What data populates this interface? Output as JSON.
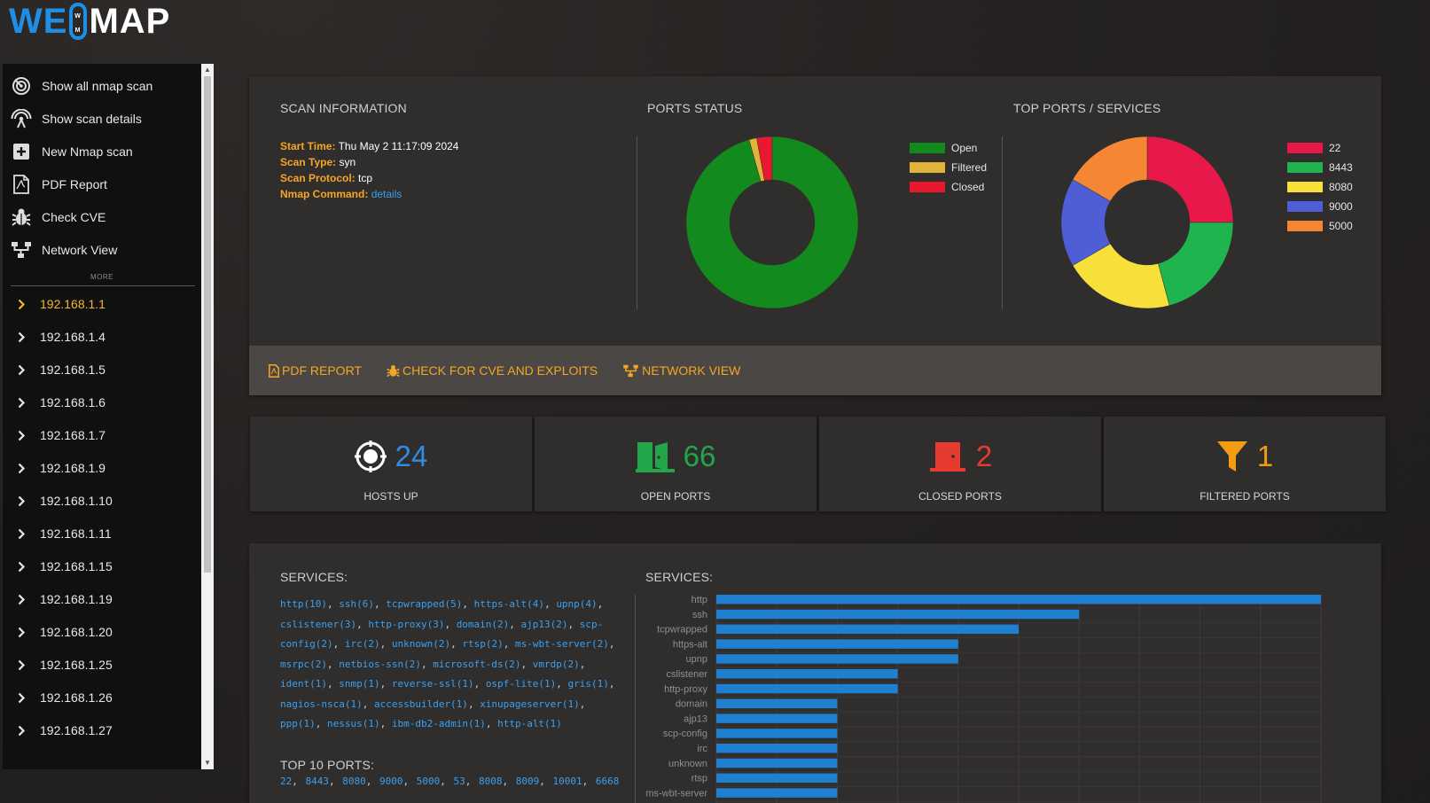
{
  "logo": {
    "part1": "WE",
    "part2": "MAP",
    "badge_letters": [
      "W",
      "M"
    ]
  },
  "sidebar": {
    "menu": [
      {
        "label": "Show all nmap scan",
        "icon": "radar-icon"
      },
      {
        "label": "Show scan details",
        "icon": "broadcast-icon"
      },
      {
        "label": "New Nmap scan",
        "icon": "plus-box-icon"
      },
      {
        "label": "PDF Report",
        "icon": "pdf-file-icon"
      },
      {
        "label": "Check CVE",
        "icon": "bug-icon"
      },
      {
        "label": "Network View",
        "icon": "network-icon"
      }
    ],
    "more_label": "MORE",
    "hosts": [
      "192.168.1.1",
      "192.168.1.4",
      "192.168.1.5",
      "192.168.1.6",
      "192.168.1.7",
      "192.168.1.9",
      "192.168.1.10",
      "192.168.1.11",
      "192.168.1.15",
      "192.168.1.19",
      "192.168.1.20",
      "192.168.1.25",
      "192.168.1.26",
      "192.168.1.27"
    ],
    "active_host": "192.168.1.1"
  },
  "scan_info": {
    "title": "SCAN INFORMATION",
    "start_time_label": "Start Time:",
    "start_time": "Thu May 2 11:17:09 2024",
    "scan_type_label": "Scan Type:",
    "scan_type": "syn",
    "scan_protocol_label": "Scan Protocol:",
    "scan_protocol": "tcp",
    "nmap_command_label": "Nmap Command:",
    "nmap_command_link": "details"
  },
  "ports_status": {
    "title": "PORTS STATUS",
    "legend": [
      {
        "label": "Open",
        "color": "#138a1e",
        "value": 66
      },
      {
        "label": "Filtered",
        "color": "#e0b438",
        "value": 1
      },
      {
        "label": "Closed",
        "color": "#e8192f",
        "value": 2
      }
    ]
  },
  "top_ports": {
    "title": "TOP PORTS / SERVICES",
    "legend": [
      {
        "label": "22",
        "color": "#e8194a",
        "value": 6
      },
      {
        "label": "8443",
        "color": "#1fb44e",
        "value": 5
      },
      {
        "label": "8080",
        "color": "#f7e03a",
        "value": 5
      },
      {
        "label": "9000",
        "color": "#4e5fd6",
        "value": 4
      },
      {
        "label": "5000",
        "color": "#f58634",
        "value": 4
      }
    ]
  },
  "actions": {
    "pdf_report": "PDF REPORT",
    "check_cve": "CHECK FOR CVE AND EXPLOITS",
    "network_view": "NETWORK VIEW"
  },
  "stats": [
    {
      "value": "24",
      "label": "HOSTS UP",
      "color": "#2d8ce6",
      "icon": "target-icon"
    },
    {
      "value": "66",
      "label": "OPEN PORTS",
      "color": "#22a64a",
      "icon": "door-open-icon"
    },
    {
      "value": "2",
      "label": "CLOSED PORTS",
      "color": "#e63b2e",
      "icon": "door-closed-icon"
    },
    {
      "value": "1",
      "label": "FILTERED PORTS",
      "color": "#f39c12",
      "icon": "filter-icon"
    }
  ],
  "services": {
    "title_left": "SERVICES:",
    "title_right": "SERVICES:",
    "list": [
      "http(10)",
      "ssh(6)",
      "tcpwrapped(5)",
      "https-alt(4)",
      "upnp(4)",
      "cslistener(3)",
      "http-proxy(3)",
      "domain(2)",
      "ajp13(2)",
      "scp-config(2)",
      "irc(2)",
      "unknown(2)",
      "rtsp(2)",
      "ms-wbt-server(2)",
      "msrpc(2)",
      "netbios-ssn(2)",
      "microsoft-ds(2)",
      "vmrdp(2)",
      "ident(1)",
      "snmp(1)",
      "reverse-ssl(1)",
      "ospf-lite(1)",
      "gris(1)",
      "nagios-nsca(1)",
      "accessbuilder(1)",
      "xinupageserver(1)",
      "ppp(1)",
      "nessus(1)",
      "ibm-db2-admin(1)",
      "http-alt(1)"
    ],
    "top10_title": "TOP 10 PORTS:",
    "top10": [
      "22",
      "8443",
      "8080",
      "9000",
      "5000",
      "53",
      "8008",
      "8009",
      "10001",
      "6668"
    ]
  },
  "chart_data": {
    "type": "bar",
    "orientation": "horizontal",
    "categories": [
      "http",
      "ssh",
      "tcpwrapped",
      "https-alt",
      "upnp",
      "cslistener",
      "http-proxy",
      "domain",
      "ajp13",
      "scp-config",
      "irc",
      "unknown",
      "rtsp",
      "ms-wbt-server"
    ],
    "values": [
      10,
      6,
      5,
      4,
      4,
      3,
      3,
      2,
      2,
      2,
      2,
      2,
      2,
      2
    ],
    "xlim": [
      0,
      10
    ],
    "bar_color": "#1f7fd1",
    "grid": true
  }
}
